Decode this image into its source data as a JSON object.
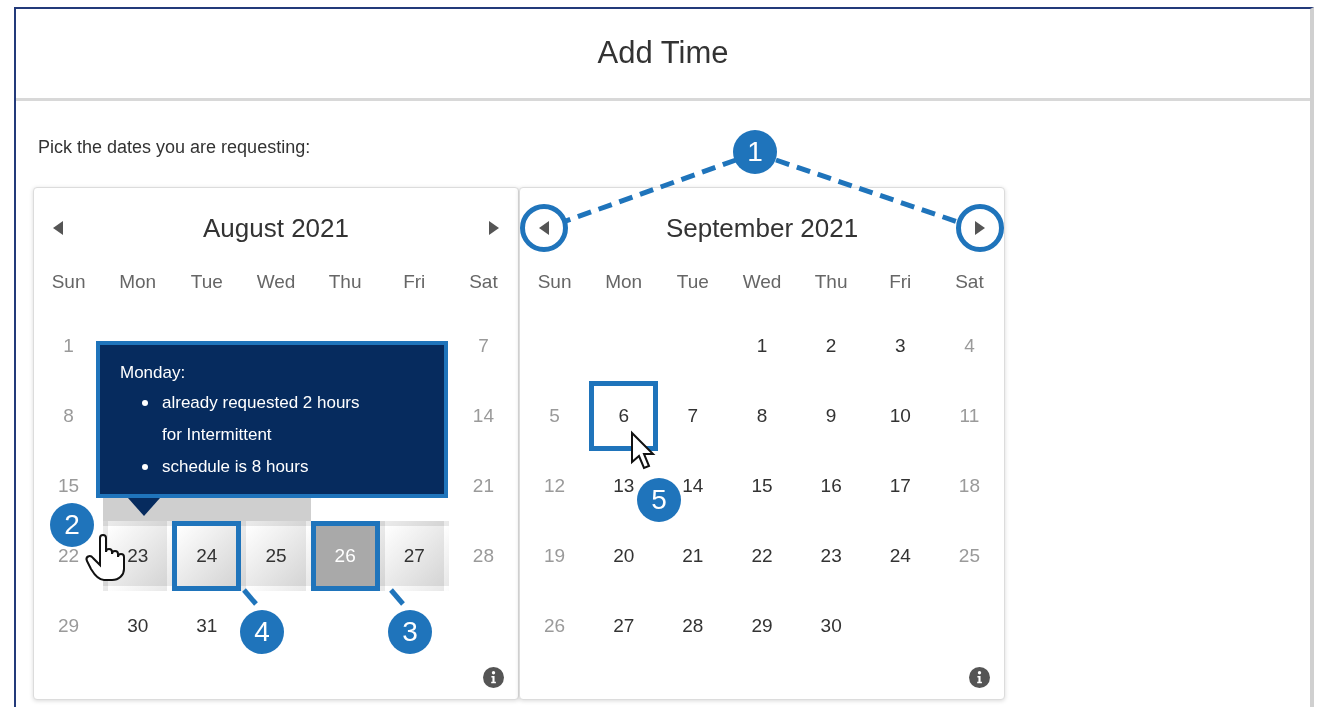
{
  "dialog": {
    "title": "Add Time"
  },
  "prompt": "Pick the dates you are requesting:",
  "calendars": [
    {
      "month": "August 2021",
      "prev": {
        "outlined": false
      },
      "next": {
        "outlined": false
      },
      "weekdays": [
        "Sun",
        "Mon",
        "Tue",
        "Wed",
        "Thu",
        "Fri",
        "Sat"
      ],
      "weeks": [
        [
          {
            "kind": "weekend",
            "day": "1",
            "selected": false,
            "outlined": false
          },
          {
            "kind": "covered",
            "selected": false
          },
          {
            "kind": "covered",
            "selected": false
          },
          {
            "kind": "covered",
            "selected": false
          },
          {
            "kind": "covered",
            "selected": false
          },
          {
            "kind": "covered",
            "selected": false
          },
          {
            "kind": "weekend",
            "day": "7",
            "selected": false,
            "outlined": false
          }
        ],
        [
          {
            "kind": "weekend",
            "day": "8",
            "selected": false,
            "outlined": false
          },
          {
            "kind": "covered"
          },
          {
            "kind": "covered"
          },
          {
            "kind": "covered"
          },
          {
            "kind": "covered"
          },
          {
            "kind": "covered"
          },
          {
            "kind": "weekend",
            "day": "14",
            "selected": false,
            "outlined": false
          }
        ],
        [
          {
            "kind": "weekend",
            "day": "15",
            "selected": false,
            "outlined": false
          },
          {
            "kind": "covered",
            "selected": true
          },
          {
            "kind": "covered",
            "selected": true
          },
          {
            "kind": "covered",
            "selected": true
          },
          {
            "kind": "covered",
            "selected": false
          },
          {
            "kind": "covered",
            "selected": false
          },
          {
            "kind": "weekend",
            "day": "21",
            "selected": false,
            "outlined": false
          }
        ],
        [
          {
            "kind": "weekend",
            "day": "22",
            "selected": false,
            "outlined": false
          },
          {
            "kind": "workday",
            "day": "23",
            "selected": true,
            "outlined": false
          },
          {
            "kind": "workday",
            "day": "24",
            "selected": true,
            "outlined": true
          },
          {
            "kind": "workday",
            "day": "25",
            "selected": true,
            "outlined": false
          },
          {
            "kind": "unavailable",
            "day": "26",
            "outlined": true
          },
          {
            "kind": "workday",
            "day": "27",
            "selected": true,
            "outlined": false
          },
          {
            "kind": "weekend",
            "day": "28",
            "selected": false,
            "outlined": false
          }
        ],
        [
          {
            "kind": "weekend",
            "day": "29",
            "selected": false,
            "outlined": false
          },
          {
            "kind": "workday",
            "day": "30",
            "selected": false,
            "outlined": false
          },
          {
            "kind": "workday",
            "day": "31",
            "selected": false,
            "outlined": false
          },
          {
            "kind": "blank"
          },
          {
            "kind": "blank"
          },
          {
            "kind": "blank"
          },
          {
            "kind": "blank"
          }
        ]
      ],
      "tooltip": {
        "title": "Monday:",
        "items": [
          "already requested 2 hours for Intermittent",
          "schedule is 8 hours"
        ]
      }
    },
    {
      "month": "September 2021",
      "prev": {
        "outlined": true
      },
      "next": {
        "outlined": true
      },
      "weekdays": [
        "Sun",
        "Mon",
        "Tue",
        "Wed",
        "Thu",
        "Fri",
        "Sat"
      ],
      "weeks": [
        [
          {
            "kind": "blank"
          },
          {
            "kind": "blank"
          },
          {
            "kind": "blank"
          },
          {
            "kind": "workday",
            "day": "1",
            "selected": false,
            "outlined": false
          },
          {
            "kind": "workday",
            "day": "2",
            "selected": false,
            "outlined": false
          },
          {
            "kind": "workday",
            "day": "3",
            "selected": false,
            "outlined": false
          },
          {
            "kind": "weekend",
            "day": "4",
            "selected": false,
            "outlined": false
          }
        ],
        [
          {
            "kind": "weekend",
            "day": "5",
            "selected": false,
            "outlined": false
          },
          {
            "kind": "workday",
            "day": "6",
            "selected": false,
            "outlined": true
          },
          {
            "kind": "workday",
            "day": "7",
            "selected": false,
            "outlined": false
          },
          {
            "kind": "workday",
            "day": "8",
            "selected": false,
            "outlined": false
          },
          {
            "kind": "workday",
            "day": "9",
            "selected": false,
            "outlined": false
          },
          {
            "kind": "workday",
            "day": "10",
            "selected": false,
            "outlined": false
          },
          {
            "kind": "weekend",
            "day": "11",
            "selected": false,
            "outlined": false
          }
        ],
        [
          {
            "kind": "weekend",
            "day": "12",
            "selected": false,
            "outlined": false
          },
          {
            "kind": "workday",
            "day": "13",
            "selected": false,
            "outlined": false
          },
          {
            "kind": "workday",
            "day": "14",
            "selected": false,
            "outlined": false
          },
          {
            "kind": "workday",
            "day": "15",
            "selected": false,
            "outlined": false
          },
          {
            "kind": "workday",
            "day": "16",
            "selected": false,
            "outlined": false
          },
          {
            "kind": "workday",
            "day": "17",
            "selected": false,
            "outlined": false
          },
          {
            "kind": "weekend",
            "day": "18",
            "selected": false,
            "outlined": false
          }
        ],
        [
          {
            "kind": "weekend",
            "day": "19",
            "selected": false,
            "outlined": false
          },
          {
            "kind": "workday",
            "day": "20",
            "selected": false,
            "outlined": false
          },
          {
            "kind": "workday",
            "day": "21",
            "selected": false,
            "outlined": false
          },
          {
            "kind": "workday",
            "day": "22",
            "selected": false,
            "outlined": false
          },
          {
            "kind": "workday",
            "day": "23",
            "selected": false,
            "outlined": false
          },
          {
            "kind": "workday",
            "day": "24",
            "selected": false,
            "outlined": false
          },
          {
            "kind": "weekend",
            "day": "25",
            "selected": false,
            "outlined": false
          }
        ],
        [
          {
            "kind": "weekend",
            "day": "26",
            "selected": false,
            "outlined": false
          },
          {
            "kind": "workday",
            "day": "27",
            "selected": false,
            "outlined": false
          },
          {
            "kind": "workday",
            "day": "28",
            "selected": false,
            "outlined": false
          },
          {
            "kind": "workday",
            "day": "29",
            "selected": false,
            "outlined": false
          },
          {
            "kind": "workday",
            "day": "30",
            "selected": false,
            "outlined": false
          },
          {
            "kind": "blank"
          },
          {
            "kind": "blank"
          }
        ]
      ]
    }
  ],
  "callouts": [
    {
      "number": "1"
    },
    {
      "number": "2"
    },
    {
      "number": "3"
    },
    {
      "number": "4"
    },
    {
      "number": "5"
    }
  ]
}
